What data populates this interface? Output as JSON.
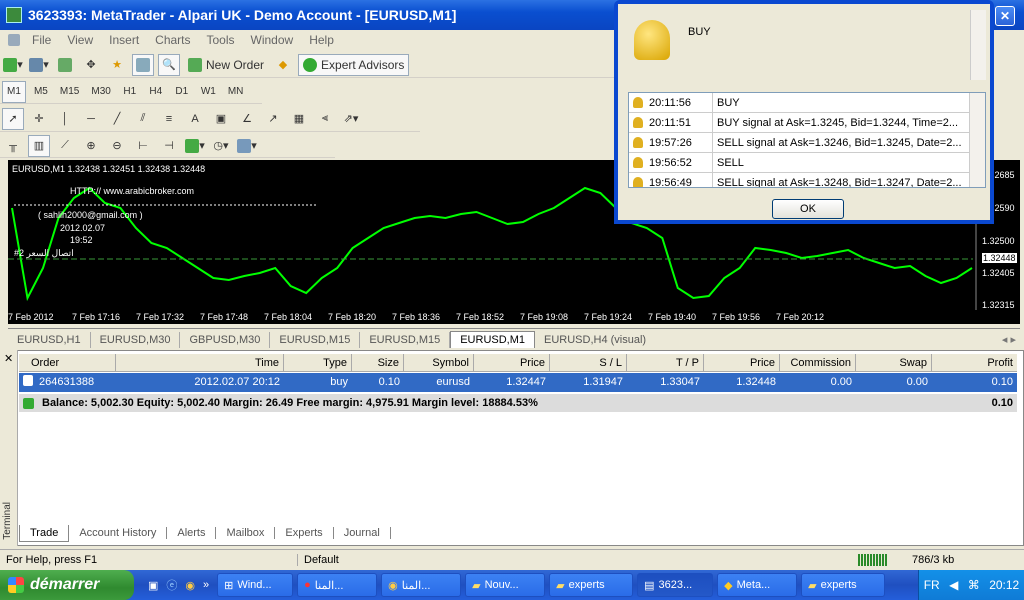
{
  "window": {
    "title": "3623393: MetaTrader - Alpari UK - Demo Account - [EURUSD,M1]"
  },
  "menu": [
    "File",
    "View",
    "Insert",
    "Charts",
    "Tools",
    "Window",
    "Help"
  ],
  "toolbar": {
    "new_order": "New Order",
    "expert_advisors": "Expert Advisors"
  },
  "timeframes": [
    "M1",
    "M5",
    "M15",
    "M30",
    "H1",
    "H4",
    "D1",
    "W1",
    "MN"
  ],
  "chart": {
    "header": "EURUSD,M1  1.32438 1.32451 1.32438 1.32448",
    "notes": [
      "HTTP:// www.arabicbroker.com",
      "( sahlih2000@gmail.com )",
      "2012.02.07",
      "19:52",
      "#2 اتصال السعر"
    ],
    "x_ticks": [
      "7 Feb 2012",
      "7 Feb 17:16",
      "7 Feb 17:32",
      "7 Feb 17:48",
      "7 Feb 18:04",
      "7 Feb 18:20",
      "7 Feb 18:36",
      "7 Feb 18:52",
      "7 Feb 19:08",
      "7 Feb 19:24",
      "7 Feb 19:40",
      "7 Feb 19:56",
      "7 Feb 20:12"
    ],
    "y_ticks": [
      "1.32685",
      "1.32590",
      "1.32500",
      "1.32448",
      "1.32405",
      "1.32315"
    ]
  },
  "chart_tabs": [
    "EURUSD,H1",
    "EURUSD,M30",
    "GBPUSD,M30",
    "EURUSD,M15",
    "EURUSD,M15",
    "EURUSD,M1",
    "EURUSD,H4 (visual)"
  ],
  "orders": {
    "headers": [
      "Order",
      "Time",
      "Type",
      "Size",
      "Symbol",
      "Price",
      "S / L",
      "T / P",
      "Price",
      "Commission",
      "Swap",
      "Profit"
    ],
    "row": [
      "264631388",
      "2012.02.07 20:12",
      "buy",
      "0.10",
      "eurusd",
      "1.32447",
      "1.31947",
      "1.33047",
      "1.32448",
      "0.00",
      "0.00",
      "0.10"
    ],
    "balance_text": "Balance: 5,002.30  Equity: 5,002.40  Margin: 26.49  Free margin: 4,975.91  Margin level: 18884.53%",
    "balance_profit": "0.10"
  },
  "terminal_tabs": [
    "Trade",
    "Account History",
    "Alerts",
    "Mailbox",
    "Experts",
    "Journal"
  ],
  "terminal_label": "Terminal",
  "status": {
    "help": "For Help, press F1",
    "profile": "Default",
    "traffic": "786/3 kb"
  },
  "taskbar": {
    "start": "démarrer",
    "items": [
      "Wind...",
      "المنا...",
      "المنا...",
      "Nouv...",
      "experts",
      "3623...",
      "Meta...",
      "experts"
    ],
    "lang": "FR",
    "clock": "20:12"
  },
  "alert_dialog": {
    "title": "BUY",
    "rows": [
      {
        "time": "20:11:56",
        "msg": "BUY"
      },
      {
        "time": "20:11:51",
        "msg": "BUY signal at Ask=1.3245, Bid=1.3244, Time=2..."
      },
      {
        "time": "19:57:26",
        "msg": "SELL signal at Ask=1.3246, Bid=1.3245, Date=2..."
      },
      {
        "time": "19:56:52",
        "msg": "SELL"
      },
      {
        "time": "19:56:49",
        "msg": "SELL signal at Ask=1.3248, Bid=1.3247, Date=2..."
      }
    ],
    "ok": "OK"
  }
}
